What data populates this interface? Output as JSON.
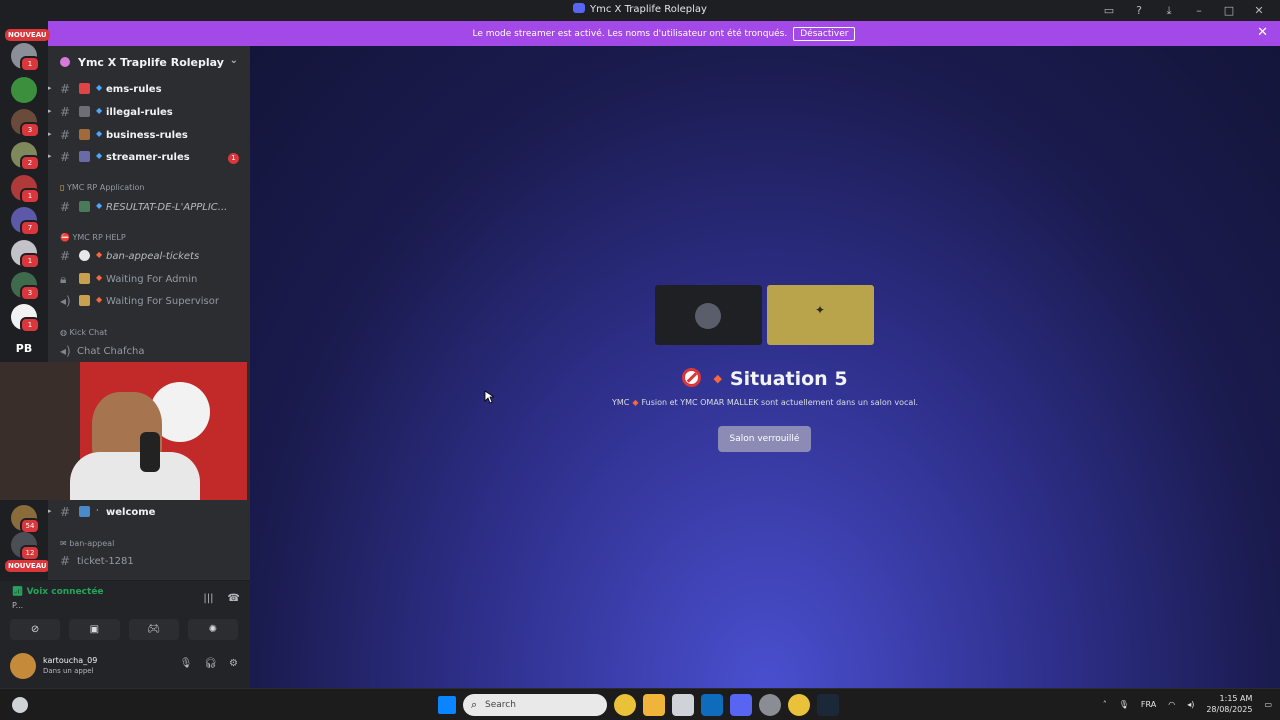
{
  "window": {
    "title": "Ymc X Traplife Roleplay"
  },
  "banner": {
    "text": "Le mode streamer est activé. Les noms d'utilisateur ont été tronqués.",
    "button": "Désactiver",
    "color": "#a349e8"
  },
  "guilds": [
    {
      "badge": "1"
    },
    {
      "badge": ""
    },
    {
      "badge": "3"
    },
    {
      "badge": "2"
    },
    {
      "badge": "1"
    },
    {
      "badge": "7"
    },
    {
      "badge": "1"
    },
    {
      "badge": "3"
    },
    {
      "badge": "1"
    },
    {
      "badge": ""
    },
    {
      "badge": "54"
    },
    {
      "badge": "12"
    }
  ],
  "guild_labels": {
    "nouveau": "NOUVEAU",
    "pb": "PB"
  },
  "server": {
    "name": "Ymc X Traplife Roleplay"
  },
  "channels": [
    {
      "label": "ems-rules",
      "style": "bold",
      "icon": "hash"
    },
    {
      "label": "illegal-rules",
      "style": "bold",
      "icon": "hash"
    },
    {
      "label": "business-rules",
      "style": "bold",
      "icon": "hash"
    },
    {
      "label": "streamer-rules",
      "style": "bold",
      "icon": "hash",
      "ping": "1"
    }
  ],
  "categories": {
    "application": "YMC RP Application",
    "help": "YMC RP HELP",
    "kick": "Kick Chat",
    "ban": "ban-appeal"
  },
  "channels2": {
    "resultat": "RESULTAT-DE-L'APPLIC...",
    "ban_tickets": "ban-appeal-tickets",
    "waiting_admin": "Waiting For Admin",
    "waiting_supervisor": "Waiting For Supervisor",
    "chat": "Chat Chafcha",
    "welcome": "welcome",
    "ticket": "ticket-1281"
  },
  "voice": {
    "status": "Voix connectée",
    "sub": "P...",
    "user": "kartoucha_09",
    "user_status": "Dans un appel"
  },
  "main": {
    "situation": "Situation 5",
    "desc_a": "YMC",
    "desc_b": "Fusion et YMC",
    "desc_c": "OMAR MALLEK sont actuellement dans un salon vocal.",
    "locked": "Salon verrouillé"
  },
  "taskbar": {
    "search": "Search",
    "lang": "FRA",
    "time": "1:15 AM",
    "date": "28/08/2025"
  },
  "icons": [
    "discord-icon",
    "search-icon",
    "chrome-icon",
    "folder-icon",
    "steam-icon",
    "windows-icon"
  ]
}
